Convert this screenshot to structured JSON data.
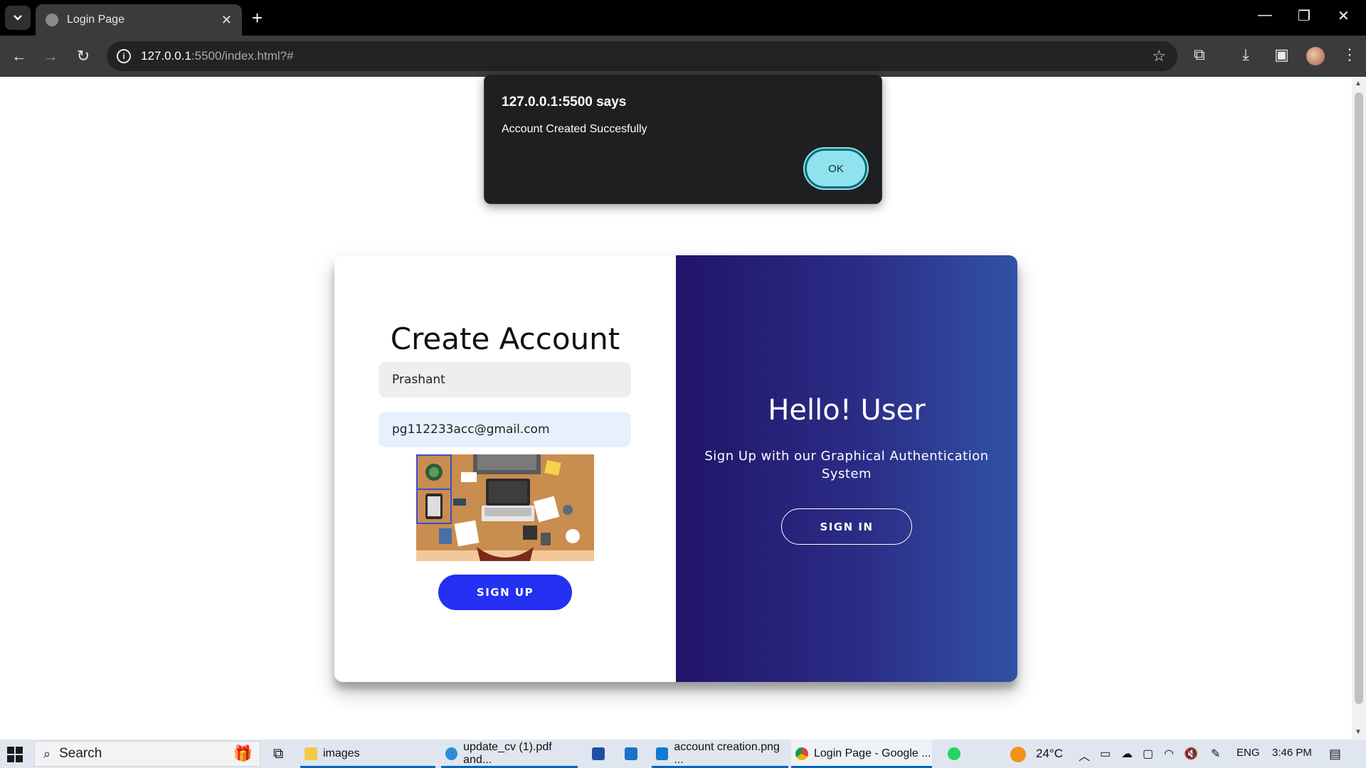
{
  "browser": {
    "tab_title": "Login Page",
    "url_host": "127.0.0.1",
    "url_path": ":5500/index.html?#"
  },
  "dialog": {
    "title": "127.0.0.1:5500 says",
    "message": "Account Created Succesfully",
    "ok_label": "OK"
  },
  "signup": {
    "heading": "Create Account",
    "name_value": "Prashant",
    "email_value": "pg112233acc@gmail.com",
    "button_label": "SIGN UP"
  },
  "overlay": {
    "heading": "Hello! User",
    "subtext": "Sign Up with our Graphical Authentication System",
    "button_label": "SIGN IN",
    "gradient_start": "#211469",
    "gradient_end": "#3152a6"
  },
  "taskbar": {
    "search_label": "Search",
    "items": [
      {
        "label": "images",
        "icon": "folder-icon"
      },
      {
        "label": "update_cv (1).pdf and...",
        "icon": "edge-icon"
      },
      {
        "label": "account creation.png ...",
        "icon": "vscode-icon"
      },
      {
        "label": "Login Page - Google ...",
        "icon": "chrome-icon"
      }
    ],
    "weather": "24°C",
    "language": "ENG",
    "time": "3:46 PM"
  },
  "colors": {
    "signup_button": "#2430f2",
    "ok_button": "#8ee3ee",
    "selection_box": "#3a4fd1"
  }
}
